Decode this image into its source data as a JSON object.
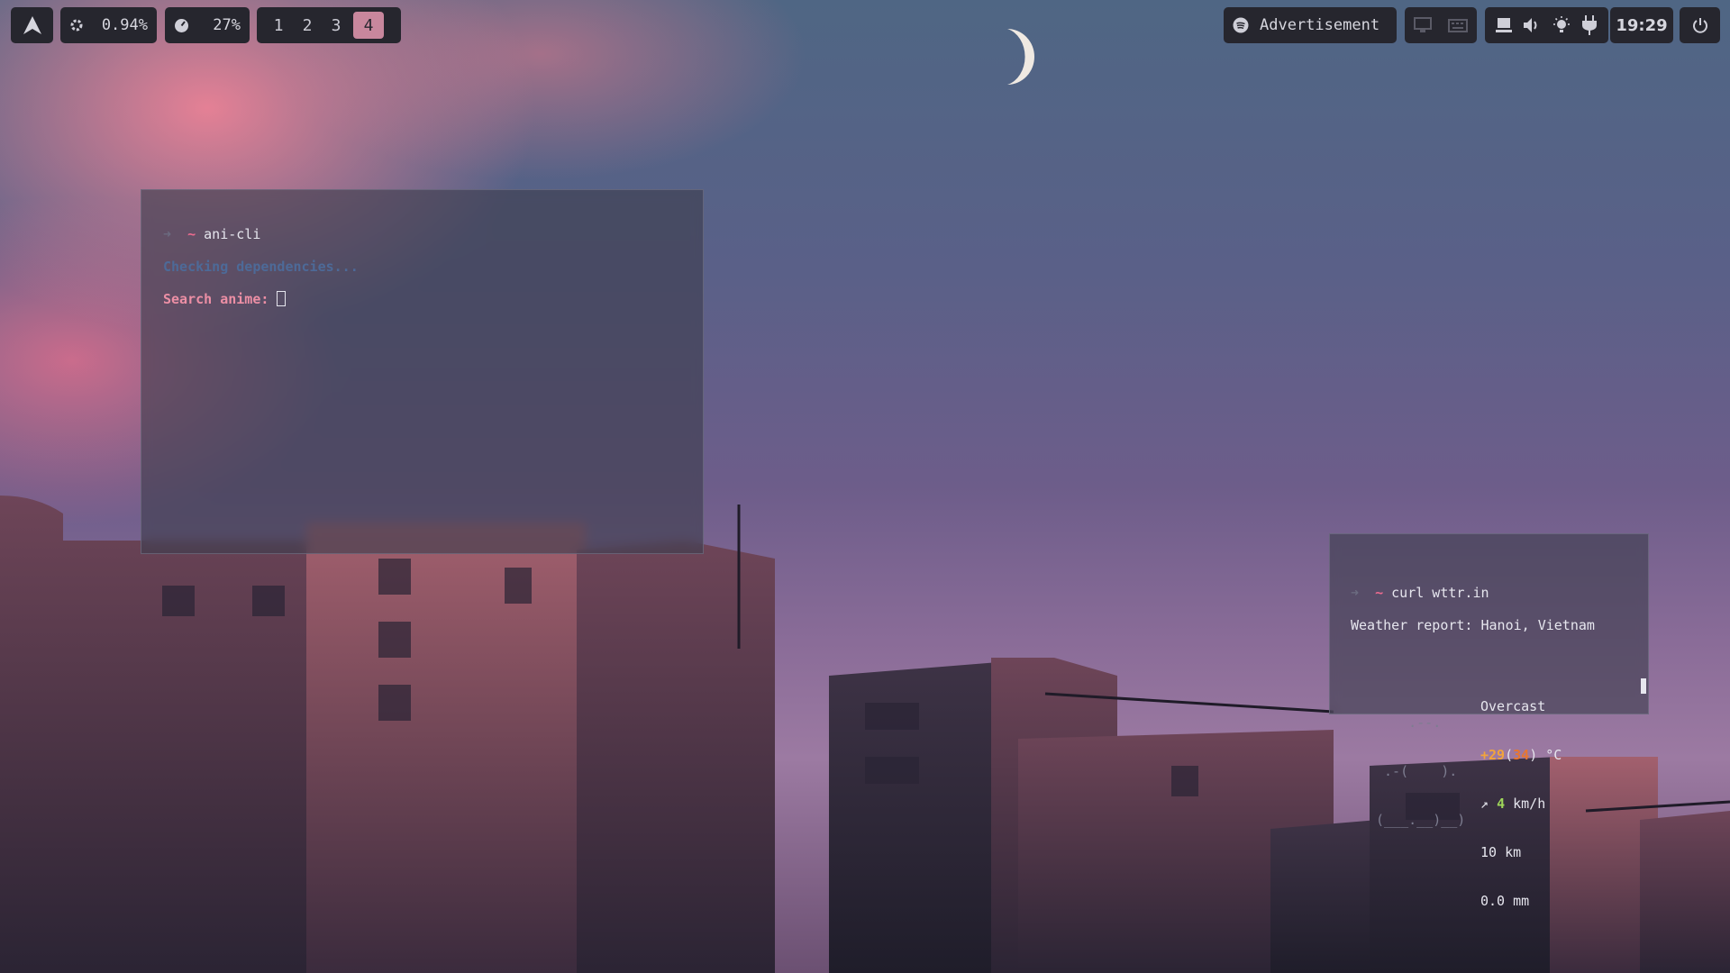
{
  "topbar": {
    "cpu": "0.94%",
    "memory": "27%",
    "workspaces": [
      "1",
      "2",
      "3",
      "4"
    ],
    "active_workspace": "4",
    "media": "Advertisement",
    "clock": "19:29"
  },
  "icons": {
    "launcher": "arch-logo-icon",
    "cpu": "cpu-icon",
    "memory": "gauge-icon",
    "media": "spotify-icon",
    "system": [
      "monitor-icon",
      "keyboard-icon",
      "network-icon",
      "volume-icon",
      "brightness-icon",
      "power-plug-icon"
    ],
    "power": "power-icon"
  },
  "terminal_anicli": {
    "prompt": "~",
    "command": "ani-cli",
    "line1": "Checking dependencies...",
    "line2": "Search anime: "
  },
  "terminal_weather": {
    "prompt": "~",
    "command": "curl wttr.in",
    "header": "Weather report: Hanoi, Vietnam",
    "condition": "Overcast",
    "temp_main": "+29",
    "temp_feel": "34",
    "temp_unit": ") °C",
    "wind_arrow": "↗",
    "wind_speed": "4",
    "wind_unit": "km/h",
    "visibility": "10 km",
    "precip": "0.0 mm",
    "ascii": [
      "    .--.   ",
      " .-(    ). ",
      "(___.__)__)"
    ]
  },
  "colors": {
    "bar_bg": "#26262e",
    "workspace_active": "#c8879d",
    "prompt_tilde": "#ec6b8f",
    "temp": "#f2a43b",
    "wind": "#9ed55a"
  }
}
